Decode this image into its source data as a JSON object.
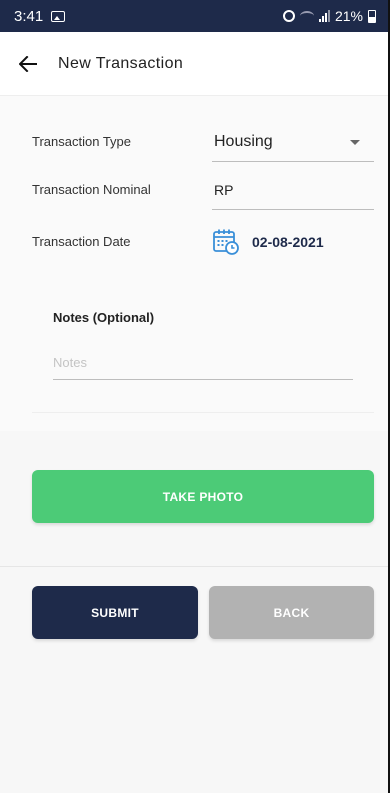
{
  "status_bar": {
    "time": "3:41",
    "battery": "21%"
  },
  "app_bar": {
    "title": "New Transaction"
  },
  "form": {
    "type": {
      "label": "Transaction Type",
      "value": "Housing"
    },
    "nominal": {
      "label": "Transaction Nominal",
      "value": "RP"
    },
    "date": {
      "label": "Transaction Date",
      "value": "02-08-2021"
    },
    "notes": {
      "label": "Notes (Optional)",
      "placeholder": "Notes"
    }
  },
  "buttons": {
    "take_photo": "TAKE PHOTO",
    "submit": "SUBMIT",
    "back": "BACK"
  },
  "colors": {
    "primary": "#1e2a4a",
    "photo_button": "#4ccb77",
    "back_button": "#b2b2b2",
    "date_icon": "#3a8fd8"
  },
  "icons": {
    "status_left": [
      "image-icon"
    ],
    "status_right": [
      "alarm-icon",
      "wifi-icon",
      "signal-icon",
      "battery-icon"
    ],
    "app_bar": "back-arrow-icon",
    "date_field": "calendar-clock-icon",
    "type_field": "dropdown-caret-icon"
  }
}
